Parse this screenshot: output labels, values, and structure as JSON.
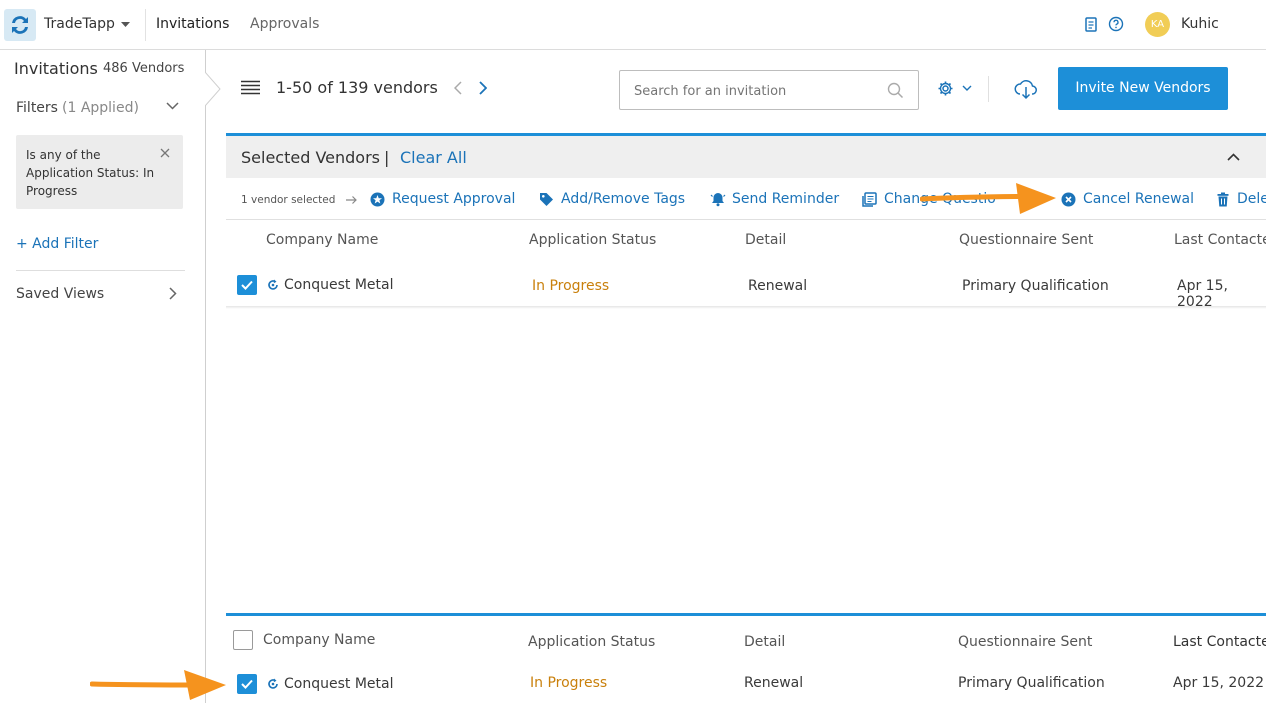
{
  "topbar": {
    "app_name": "TradeTapp",
    "nav": [
      "Invitations",
      "Approvals"
    ],
    "user_initials": "KA",
    "user_name": "Kuhic"
  },
  "sidebar": {
    "title": "Invitations",
    "vendor_count": "486 Vendors",
    "filters_label": "Filters",
    "filters_applied": "(1 Applied)",
    "filter_chip_text": "Is any of the Application Status: In Progress",
    "add_filter": "+ Add Filter",
    "saved_views": "Saved Views"
  },
  "toolbar": {
    "pagination": "1-50 of 139 vendors",
    "search_placeholder": "Search for an invitation",
    "invite_button": "Invite New Vendors"
  },
  "selected_panel": {
    "title": "Selected Vendors",
    "separator": "|",
    "clear_all": "Clear All",
    "selected_count": "1 vendor selected",
    "actions": [
      "Request Approval",
      "Add/Remove Tags",
      "Send Reminder",
      "Change Questio",
      "Cancel Renewal",
      "Dele"
    ]
  },
  "table": {
    "columns": [
      "Company Name",
      "Application Status",
      "Detail",
      "Questionnaire Sent",
      "Last Contacted"
    ],
    "selected_row": {
      "company": "Conquest Metal",
      "status": "In Progress",
      "detail": "Renewal",
      "questionnaire": "Primary Qualification",
      "last_contacted": "Apr 15, 2022"
    },
    "bottom_columns": [
      "Company Name",
      "Application Status",
      "Detail",
      "Questionnaire Sent",
      "Last Contacted"
    ],
    "bottom_row": {
      "company": "Conquest Metal",
      "status": "In Progress",
      "detail": "Renewal",
      "questionnaire": "Primary Qualification",
      "last_contacted": "Apr 15, 2022"
    }
  },
  "colors": {
    "accent": "#1d8fd8",
    "link": "#1b73b8",
    "status": "#c9800c",
    "annotation_arrow": "#f5931e"
  }
}
